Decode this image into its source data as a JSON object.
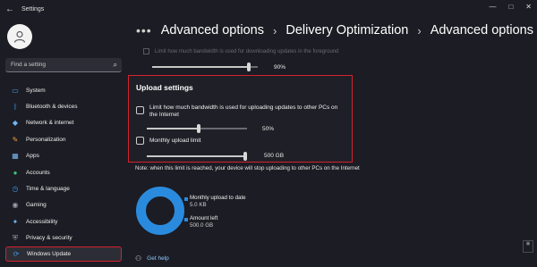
{
  "app": {
    "title": "Settings",
    "back_glyph": "←",
    "window_controls": [
      "—",
      "□",
      "✕"
    ]
  },
  "search": {
    "placeholder": "Find a setting",
    "icon": "search-icon"
  },
  "sidebar": {
    "items": [
      {
        "label": "System",
        "icon": "system-monitor-icon",
        "color": "#3b9ae8"
      },
      {
        "label": "Bluetooth & devices",
        "icon": "bluetooth-icon",
        "color": "#3b9ae8"
      },
      {
        "label": "Network & internet",
        "icon": "wifi-icon",
        "color": "#6fb6f5"
      },
      {
        "label": "Personalization",
        "icon": "brush-icon",
        "color": "#f0a03a"
      },
      {
        "label": "Apps",
        "icon": "apps-grid-icon",
        "color": "#7ab8f0"
      },
      {
        "label": "Accounts",
        "icon": "account-person-icon",
        "color": "#3ec07a"
      },
      {
        "label": "Time & language",
        "icon": "globe-clock-icon",
        "color": "#3b9ae8"
      },
      {
        "label": "Gaming",
        "icon": "gamepad-icon",
        "color": "#9aa0aa"
      },
      {
        "label": "Accessibility",
        "icon": "accessibility-icon",
        "color": "#6fb6f5"
      },
      {
        "label": "Privacy & security",
        "icon": "shield-icon",
        "color": "#9aa0aa"
      },
      {
        "label": "Windows Update",
        "icon": "windows-update-icon",
        "color": "#3b9ae8",
        "selected": true
      }
    ]
  },
  "breadcrumb": {
    "dots": "•••",
    "sep": "›",
    "items": [
      "Advanced options",
      "Delivery Optimization",
      "Advanced options"
    ]
  },
  "download": {
    "label": "Limit how much bandwidth is used for downloading updates in the foreground",
    "value": "90%",
    "level_percent": 90
  },
  "upload": {
    "title": "Upload settings",
    "bandwidth_label": "Limit how much bandwidth is used for uploading updates to other PCs on the Internet",
    "bandwidth_value": "50%",
    "bandwidth_percent": 50,
    "monthly_label": "Monthly upload limit",
    "monthly_value": "500 GB",
    "monthly_percent": 100
  },
  "note": "Note: when this limit is reached, your device will stop uploading to other PCs on the Internet",
  "usage": {
    "monthly_label": "Monthly upload to date",
    "monthly_value": "5.0 KB",
    "left_label": "Amount left",
    "left_value": "500.0 GB",
    "accent": "#2a8bde"
  },
  "help": {
    "label": "Get help",
    "icon": "get-help-icon"
  },
  "colors": {
    "background": "#1c1c24",
    "highlight": "#d4212c",
    "accent": "#2a8bde"
  }
}
